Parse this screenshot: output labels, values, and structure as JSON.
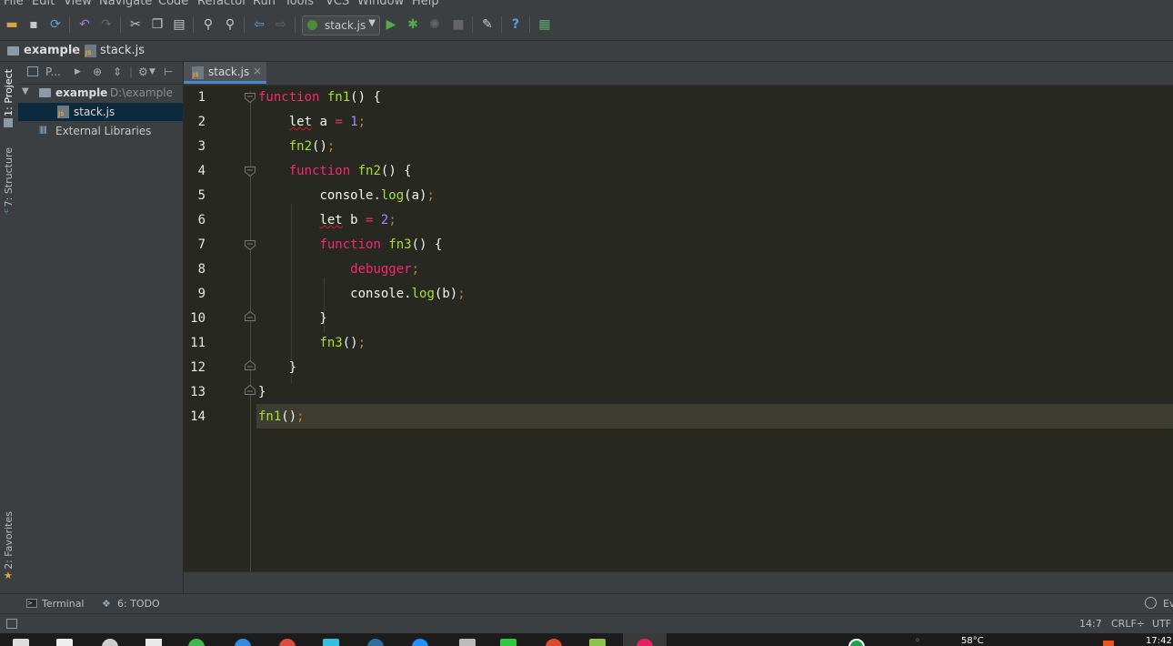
{
  "menu": [
    "File",
    "Edit",
    "View",
    "Navigate",
    "Code",
    "Refactor",
    "Run",
    "Tools",
    "VCS",
    "Window",
    "Help"
  ],
  "toolbar": {
    "run_config": "stack.js"
  },
  "navbar": {
    "project": "example",
    "file": "stack.js"
  },
  "left_strip": {
    "project_tab": "1: Project",
    "structure_tab": "7: Structure",
    "favorites_tab": "2: Favorites"
  },
  "project_panel": {
    "header_label": "P...",
    "tree": {
      "root_name": "example",
      "root_path": "D:\\example",
      "file": "stack.js",
      "libraries": "External Libraries"
    }
  },
  "editor": {
    "tab_label": "stack.js",
    "tab_close": "×",
    "line_numbers": [
      "1",
      "2",
      "3",
      "4",
      "5",
      "6",
      "7",
      "8",
      "9",
      "10",
      "11",
      "12",
      "13",
      "14"
    ],
    "tokens": {
      "function": "function",
      "fn1": "fn1",
      "fn2": "fn2",
      "fn3": "fn3",
      "let": "let",
      "a": "a",
      "b": "b",
      "one": "1",
      "two": "2",
      "console": "console.",
      "log": "log",
      "debugger": "debugger"
    }
  },
  "bottom_bar": {
    "terminal": "Terminal",
    "todo": "6: TODO",
    "event_log": "Ev"
  },
  "status_bar": {
    "position": "14:7",
    "line_sep": "CRLF÷",
    "encoding": "UTF"
  },
  "taskbar": {
    "temperature": "58°C",
    "time": "17:42"
  },
  "colors": {
    "keyword": "#f92672",
    "function": "#a6e22e",
    "number": "#ae81ff",
    "editor_bg": "#272822",
    "accent": "#4a88c7"
  }
}
